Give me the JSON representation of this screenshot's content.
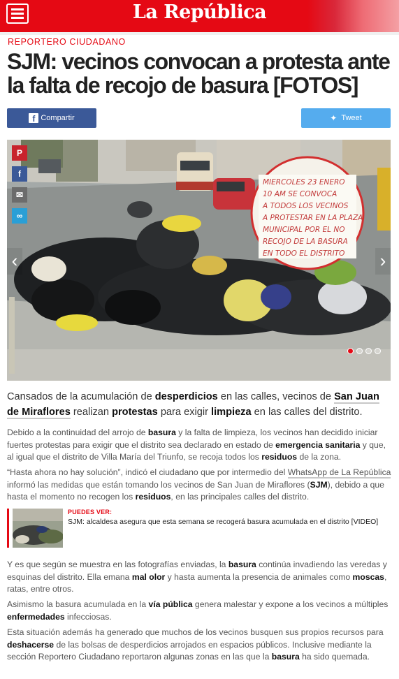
{
  "header": {
    "logo": "La República",
    "accent_color": "#e50914",
    "menu_icon": "hamburger-icon"
  },
  "article": {
    "section": "REPORTERO CIUDADANO",
    "headline": "SJM: vecinos convocan a protesta ante la falta de recojo de basura [FOTOS]"
  },
  "share": {
    "facebook_label": "Compartir",
    "twitter_label": "Tweet",
    "side_icons": [
      "pinterest-icon",
      "facebook-icon",
      "email-icon",
      "link-icon"
    ]
  },
  "photo": {
    "sign_text": [
      "MIERCOLES 23 ENERO",
      "10 AM SE CONVOCA",
      "A TODOS LOS VECINOS",
      "A PROTESTAR EN LA PLAZA",
      "MUNICIPAL POR EL NO",
      "RECOJO DE LA BASURA",
      "EN TODO EL DISTRITO"
    ],
    "slides_total": 4,
    "active_slide": 1
  },
  "lead": {
    "t1": "Cansados de la acumulación de ",
    "b1": "desperdicios",
    "t2": " en las calles, vecinos de ",
    "l1": "San Juan de Miraflores",
    "t3": " realizan ",
    "b2": "protestas",
    "t4": " para exigir ",
    "b3": "limpieza",
    "t5": " en las calles del distrito."
  },
  "p1": {
    "t1": "Debido a la continuidad del arrojo de ",
    "b1": "basura",
    "t2": " y la falta de limpieza, los vecinos han decidido iniciar fuertes protestas para exigir que el distrito sea declarado en estado de ",
    "b2": "emergencia sanitaria",
    "t3": " y que, al igual que el distrito de Villa María del Triunfo, se recoja todos los ",
    "b3": "residuos",
    "t4": " de la zona."
  },
  "p2": {
    "t1": "“Hasta ahora no hay solución”, indicó el ciudadano que por intermedio del ",
    "l1": "WhatsApp de La República",
    "t2": " informó las medidas que están tomando los vecinos de San Juan de Miraflores (",
    "b1": "SJM",
    "t3": "), debido a que hasta el momento no recogen los ",
    "b2": "residuos",
    "t4": ", en las principales calles del distrito."
  },
  "related": {
    "kicker": "PUEDES VER:",
    "title": "SJM: alcaldesa asegura que esta semana se recogerá basura acumulada en el distrito [VIDEO]"
  },
  "p3": {
    "t1": "Y es que según se muestra en las fotografías enviadas, la ",
    "b1": "basura",
    "t2": " continúa invadiendo las veredas y esquinas del distrito. Ella emana ",
    "b2": "mal olor",
    "t3": " y hasta aumenta la presencia de animales como ",
    "b3": "moscas",
    "t4": ", ratas, entre otros."
  },
  "p4": {
    "t1": "Asimismo la basura acumulada en la ",
    "b1": "vía pública",
    "t2": " genera malestar y expone a los vecinos a múltiples ",
    "b2": "enfermedades",
    "t3": " infecciosas."
  },
  "p5": {
    "t1": "Esta situación además ha generado que muchos de los vecinos busquen sus propios recursos para ",
    "b1": "deshacerse",
    "t2": " de las bolsas de desperdicios arrojados en espacios públicos. Inclusive mediante la sección Reportero Ciudadano reportaron algunas zonas en las que la ",
    "b2": "basura",
    "t3": " ha sido quemada."
  }
}
